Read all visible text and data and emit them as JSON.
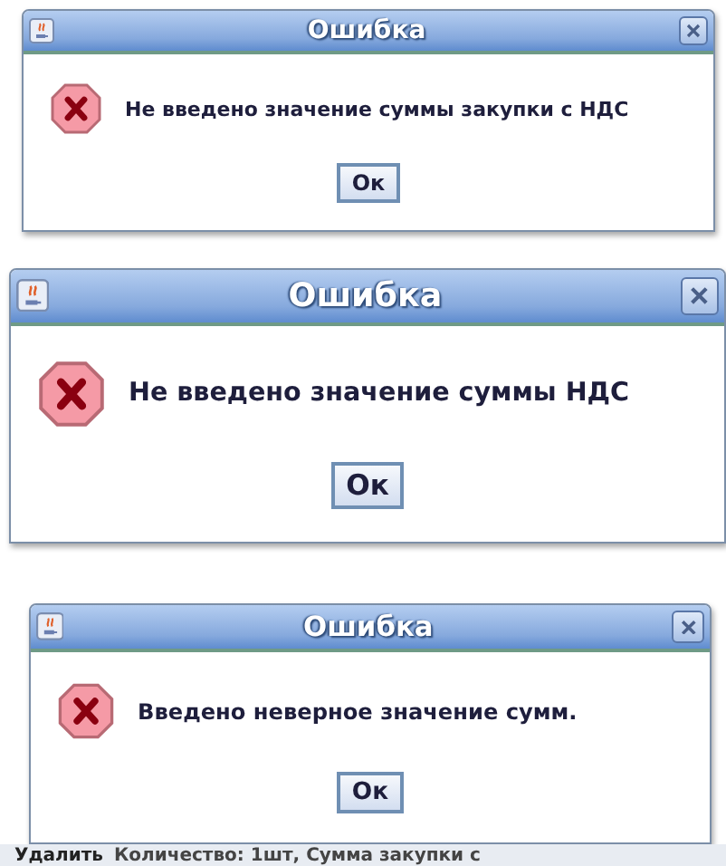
{
  "dialogs": [
    {
      "title": "Ошибка",
      "message": "Не введено значение суммы закупки с НДС",
      "button": "Ок"
    },
    {
      "title": "Ошибка",
      "message": "Не введено значение суммы НДС",
      "button": "Ок"
    },
    {
      "title": "Ошибка",
      "message": "Введено неверное значение сумм.",
      "button": "Ок"
    }
  ],
  "background_row": {
    "button": "Удалить",
    "text": "Количество: 1шт, Сумма закупки с"
  }
}
